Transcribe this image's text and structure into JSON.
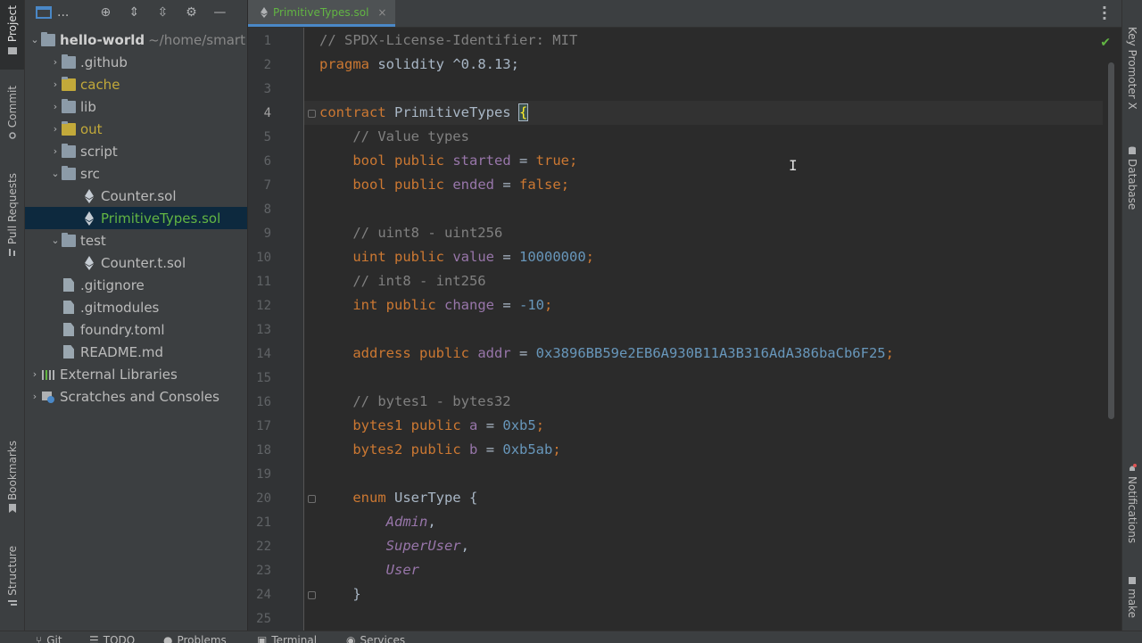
{
  "left_tabs": [
    "Project",
    "Commit",
    "Pull Requests",
    "Bookmarks",
    "Structure"
  ],
  "right_tabs": [
    "Key Promoter X",
    "Database",
    "Notifications",
    "make"
  ],
  "project_panel": {
    "title": "...",
    "tree": [
      {
        "name": "hello-world",
        "suffix": "~/home/smart",
        "kind": "root",
        "expanded": true,
        "depth": 0
      },
      {
        "name": ".github",
        "kind": "folder",
        "expanded": false,
        "depth": 1
      },
      {
        "name": "cache",
        "kind": "folder-excluded",
        "expanded": false,
        "depth": 1
      },
      {
        "name": "lib",
        "kind": "folder",
        "expanded": false,
        "depth": 1
      },
      {
        "name": "out",
        "kind": "folder-excluded",
        "expanded": false,
        "depth": 1
      },
      {
        "name": "script",
        "kind": "folder",
        "expanded": false,
        "depth": 1
      },
      {
        "name": "src",
        "kind": "folder",
        "expanded": true,
        "depth": 1
      },
      {
        "name": "Counter.sol",
        "kind": "sol",
        "depth": 2
      },
      {
        "name": "PrimitiveTypes.sol",
        "kind": "sol-active",
        "depth": 2
      },
      {
        "name": "test",
        "kind": "folder",
        "expanded": true,
        "depth": 1
      },
      {
        "name": "Counter.t.sol",
        "kind": "sol",
        "depth": 2
      },
      {
        "name": ".gitignore",
        "kind": "file",
        "depth": 1
      },
      {
        "name": ".gitmodules",
        "kind": "file",
        "depth": 1
      },
      {
        "name": "foundry.toml",
        "kind": "file",
        "depth": 1
      },
      {
        "name": "README.md",
        "kind": "file",
        "depth": 1
      },
      {
        "name": "External Libraries",
        "kind": "libs",
        "expanded": false,
        "depth": 0
      },
      {
        "name": "Scratches and Consoles",
        "kind": "scratch",
        "expanded": false,
        "depth": 0
      }
    ]
  },
  "editor": {
    "tab_label": "PrimitiveTypes.sol",
    "current_line": 4,
    "lines": [
      [
        [
          "cm",
          "// SPDX-License-Identifier: MIT"
        ]
      ],
      [
        [
          "kw",
          "pragma"
        ],
        [
          "plain",
          " solidity ^0.8.13;"
        ]
      ],
      [],
      [
        [
          "kw",
          "contract"
        ],
        [
          "plain",
          " PrimitiveTypes "
        ],
        [
          "brace",
          "{"
        ]
      ],
      [
        [
          "plain",
          "    "
        ],
        [
          "cm",
          "// Value types"
        ]
      ],
      [
        [
          "plain",
          "    "
        ],
        [
          "ty",
          "bool"
        ],
        [
          "plain",
          " "
        ],
        [
          "kw",
          "public"
        ],
        [
          "plain",
          " "
        ],
        [
          "id",
          "started"
        ],
        [
          "plain",
          " = "
        ],
        [
          "kw",
          "true"
        ],
        [
          "kw",
          ";"
        ]
      ],
      [
        [
          "plain",
          "    "
        ],
        [
          "ty",
          "bool"
        ],
        [
          "plain",
          " "
        ],
        [
          "kw",
          "public"
        ],
        [
          "plain",
          " "
        ],
        [
          "id",
          "ended"
        ],
        [
          "plain",
          " = "
        ],
        [
          "kw",
          "false"
        ],
        [
          "kw",
          ";"
        ]
      ],
      [],
      [
        [
          "plain",
          "    "
        ],
        [
          "cm",
          "// uint8 - uint256"
        ]
      ],
      [
        [
          "plain",
          "    "
        ],
        [
          "ty",
          "uint"
        ],
        [
          "plain",
          " "
        ],
        [
          "kw",
          "public"
        ],
        [
          "plain",
          " "
        ],
        [
          "id",
          "value"
        ],
        [
          "plain",
          " = "
        ],
        [
          "num",
          "10000000"
        ],
        [
          "kw",
          ";"
        ]
      ],
      [
        [
          "plain",
          "    "
        ],
        [
          "cm",
          "// int8 - int256"
        ]
      ],
      [
        [
          "plain",
          "    "
        ],
        [
          "ty",
          "int"
        ],
        [
          "plain",
          " "
        ],
        [
          "kw",
          "public"
        ],
        [
          "plain",
          " "
        ],
        [
          "id",
          "change"
        ],
        [
          "plain",
          " = "
        ],
        [
          "num",
          "-10"
        ],
        [
          "kw",
          ";"
        ]
      ],
      [],
      [
        [
          "plain",
          "    "
        ],
        [
          "ty",
          "address"
        ],
        [
          "plain",
          " "
        ],
        [
          "kw",
          "public"
        ],
        [
          "plain",
          " "
        ],
        [
          "id",
          "addr"
        ],
        [
          "plain",
          " = "
        ],
        [
          "num",
          "0x3896BB59e2EB6A930B11A3B316AdA386baCb6F25"
        ],
        [
          "kw",
          ";"
        ]
      ],
      [],
      [
        [
          "plain",
          "    "
        ],
        [
          "cm",
          "// bytes1 - bytes32"
        ]
      ],
      [
        [
          "plain",
          "    "
        ],
        [
          "ty",
          "bytes1"
        ],
        [
          "plain",
          " "
        ],
        [
          "kw",
          "public"
        ],
        [
          "plain",
          " "
        ],
        [
          "id",
          "a"
        ],
        [
          "plain",
          " = "
        ],
        [
          "num",
          "0xb5"
        ],
        [
          "kw",
          ";"
        ]
      ],
      [
        [
          "plain",
          "    "
        ],
        [
          "ty",
          "bytes2"
        ],
        [
          "plain",
          " "
        ],
        [
          "kw",
          "public"
        ],
        [
          "plain",
          " "
        ],
        [
          "id",
          "b"
        ],
        [
          "plain",
          " = "
        ],
        [
          "num",
          "0xb5ab"
        ],
        [
          "kw",
          ";"
        ]
      ],
      [],
      [
        [
          "plain",
          "    "
        ],
        [
          "kw",
          "enum"
        ],
        [
          "plain",
          " UserType {"
        ]
      ],
      [
        [
          "plain",
          "        "
        ],
        [
          "en",
          "Admin"
        ],
        [
          "plain",
          ","
        ]
      ],
      [
        [
          "plain",
          "        "
        ],
        [
          "en",
          "SuperUser"
        ],
        [
          "plain",
          ","
        ]
      ],
      [
        [
          "plain",
          "        "
        ],
        [
          "en",
          "User"
        ]
      ],
      [
        [
          "plain",
          "    }"
        ]
      ],
      []
    ]
  },
  "bottom_tabs": [
    "Git",
    "TODO",
    "Problems",
    "Terminal",
    "Services"
  ]
}
